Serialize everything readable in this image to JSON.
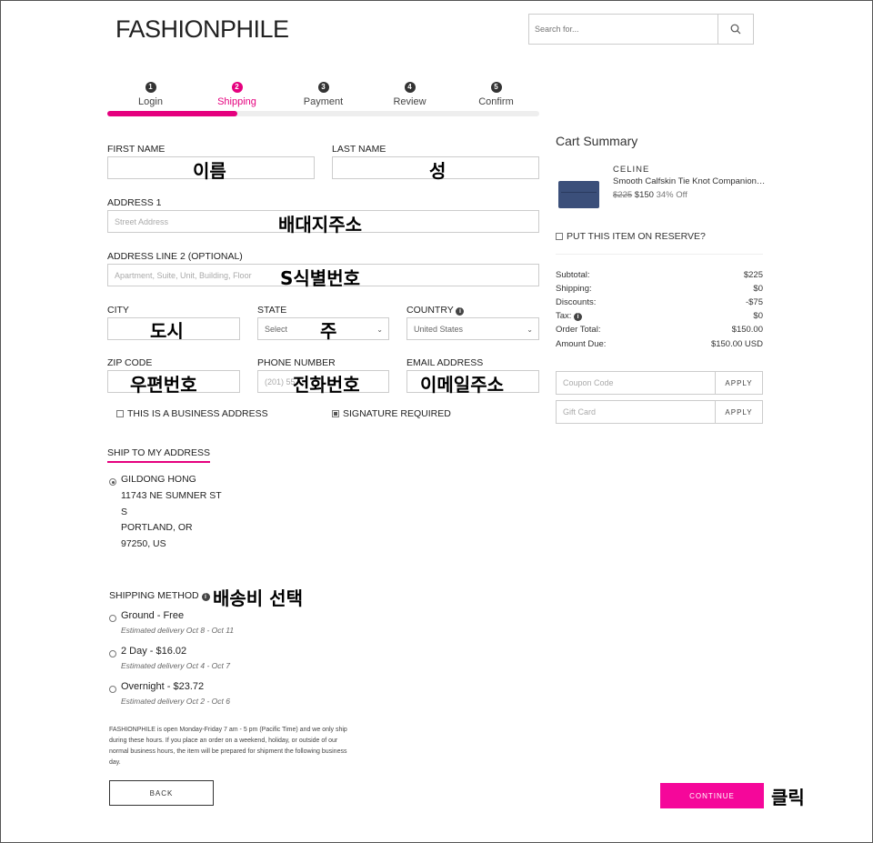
{
  "header": {
    "logo": "FASHIONPHILE",
    "search_placeholder": "Search for..."
  },
  "steps": [
    {
      "num": "1",
      "label": "Login"
    },
    {
      "num": "2",
      "label": "Shipping"
    },
    {
      "num": "3",
      "label": "Payment"
    },
    {
      "num": "4",
      "label": "Review"
    },
    {
      "num": "5",
      "label": "Confirm"
    }
  ],
  "form": {
    "first_name_label": "FIRST NAME",
    "last_name_label": "LAST NAME",
    "address1_label": "ADDRESS 1",
    "address1_placeholder": "Street Address",
    "address2_label": "ADDRESS LINE 2 (OPTIONAL)",
    "address2_placeholder": "Apartment, Suite, Unit, Building, Floor",
    "city_label": "CITY",
    "state_label": "STATE",
    "state_value": "Select",
    "country_label": "COUNTRY",
    "country_value": "United States",
    "zip_label": "ZIP CODE",
    "phone_label": "PHONE NUMBER",
    "phone_placeholder": "(201) 55",
    "email_label": "EMAIL ADDRESS",
    "business_label": "THIS IS A BUSINESS ADDRESS",
    "signature_label": "SIGNATURE REQUIRED"
  },
  "overlays": {
    "first_name": "이름",
    "last_name": "성",
    "address1": "배대지주소",
    "address2": "S식별번호",
    "city": "도시",
    "state": "주",
    "zip": "우편번호",
    "phone": "전화번호",
    "email": "이메일주소",
    "shipping_method": "배송비 선택",
    "continue": "클릭"
  },
  "ship_to": {
    "tab": "SHIP TO MY ADDRESS",
    "lines": [
      "GILDONG HONG",
      "11743 NE SUMNER ST",
      "S",
      "PORTLAND, OR",
      "97250, US"
    ]
  },
  "shipping": {
    "title": "SHIPPING METHOD",
    "options": [
      {
        "label": "Ground - Free",
        "sub": "Estimated delivery Oct 8 - Oct 11"
      },
      {
        "label": "2 Day - $16.02",
        "sub": "Estimated delivery Oct 4 - Oct 7"
      },
      {
        "label": "Overnight - $23.72",
        "sub": "Estimated delivery Oct 2 - Oct 6"
      }
    ],
    "notice": "FASHIONPHILE is open Monday-Friday 7 am - 5 pm (Pacific Time) and we only ship during these hours. If you place an order on a weekend, holiday, or outside of our normal business hours, the item will be prepared for shipment the following business day."
  },
  "buttons": {
    "back": "BACK",
    "continue": "CONTINUE"
  },
  "cart": {
    "title": "Cart Summary",
    "item": {
      "brand": "CELINE",
      "name": "Smooth Calfskin Tie Knot Companion ...",
      "orig_price": "$225",
      "price": "$150",
      "off": "34% Off"
    },
    "reserve_label": "PUT THIS ITEM ON RESERVE?",
    "summary": [
      {
        "label": "Subtotal:",
        "value": "$225"
      },
      {
        "label": "Shipping:",
        "value": "$0"
      },
      {
        "label": "Discounts:",
        "value": "-$75"
      },
      {
        "label": "Tax:",
        "value": "$0"
      },
      {
        "label": "Order Total:",
        "value": "$150.00"
      },
      {
        "label": "Amount Due:",
        "value": "$150.00 USD"
      }
    ],
    "coupon_placeholder": "Coupon Code",
    "giftcard_placeholder": "Gift Card",
    "apply_label": "APPLY"
  },
  "colors": {
    "accent": "#e5007e",
    "continue_bg": "#f5079a",
    "wallet": "#3b4f7a"
  }
}
